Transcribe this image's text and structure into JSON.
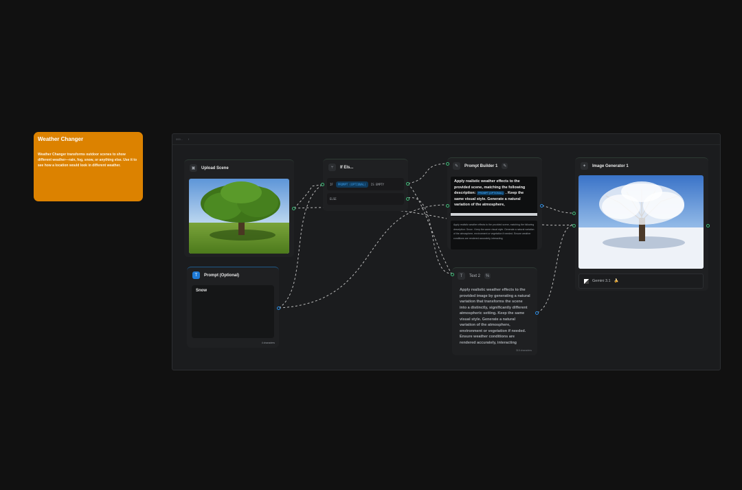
{
  "sticky": {
    "title": "Weather Changer",
    "body": "Weather Changer transforms outdoor scenes to show different weather—rain, fog, snow, or anything else. Use it to see how a location would look in different weather."
  },
  "group": {
    "label_a": "000...",
    "label_b": "f"
  },
  "upload": {
    "title": "Upload Scene",
    "icon": "image-icon"
  },
  "prompt": {
    "title": "Prompt (Optional)",
    "icon": "text-icon",
    "badge": "T",
    "value": "Snow",
    "char_count": "4 characters"
  },
  "ifelse": {
    "title": "If Els...",
    "icon": "branch-icon",
    "if_kw": "IF",
    "if_token": "PROMPT (OPTIONAL)",
    "if_cond": "IS EMPTY",
    "else_kw": "ELSE"
  },
  "builder": {
    "title": "Prompt Builder 1",
    "icon": "builder-icon",
    "text_before": "Apply realistic weather effects to the provided scene, matching the following description:",
    "token": "PROMPT (OPTIONAL)",
    "text_after": ". Keep the same visual style. Generate a natural variation of the atmosphere,",
    "preview": "Apply realistic weather effects to the provided scene, matching the following description: Snow . Keep the same visual style. Generate a natural variation of the atmosphere, environment or vegetation if needed. Ensure weather conditions are rendered accurately, interacting"
  },
  "text2": {
    "title": "Text 2",
    "icon": "text-icon",
    "body": "Apply realistic weather effects to the provided image by generating a natural variation that transforms the scene into a distinctly, significantly different atmospheric setting. Keep the same visual style. Generate a natural variation of the atmosphere, environment or vegetation if needed. Ensure weather conditions are rendered accurately, interacting",
    "char_count": "315 characters"
  },
  "generator": {
    "title": "Image Generator 1",
    "icon": "sparkle-icon",
    "model": "Gemini 3.1",
    "model_emoji": "🍌"
  },
  "colors": {
    "sticky": "#dc8200",
    "canvas": "#111111",
    "group": "#1b1c1e",
    "port_green": "#3fbf7a",
    "port_blue": "#2b8fe8",
    "token_blue": "#0f3a5c"
  }
}
